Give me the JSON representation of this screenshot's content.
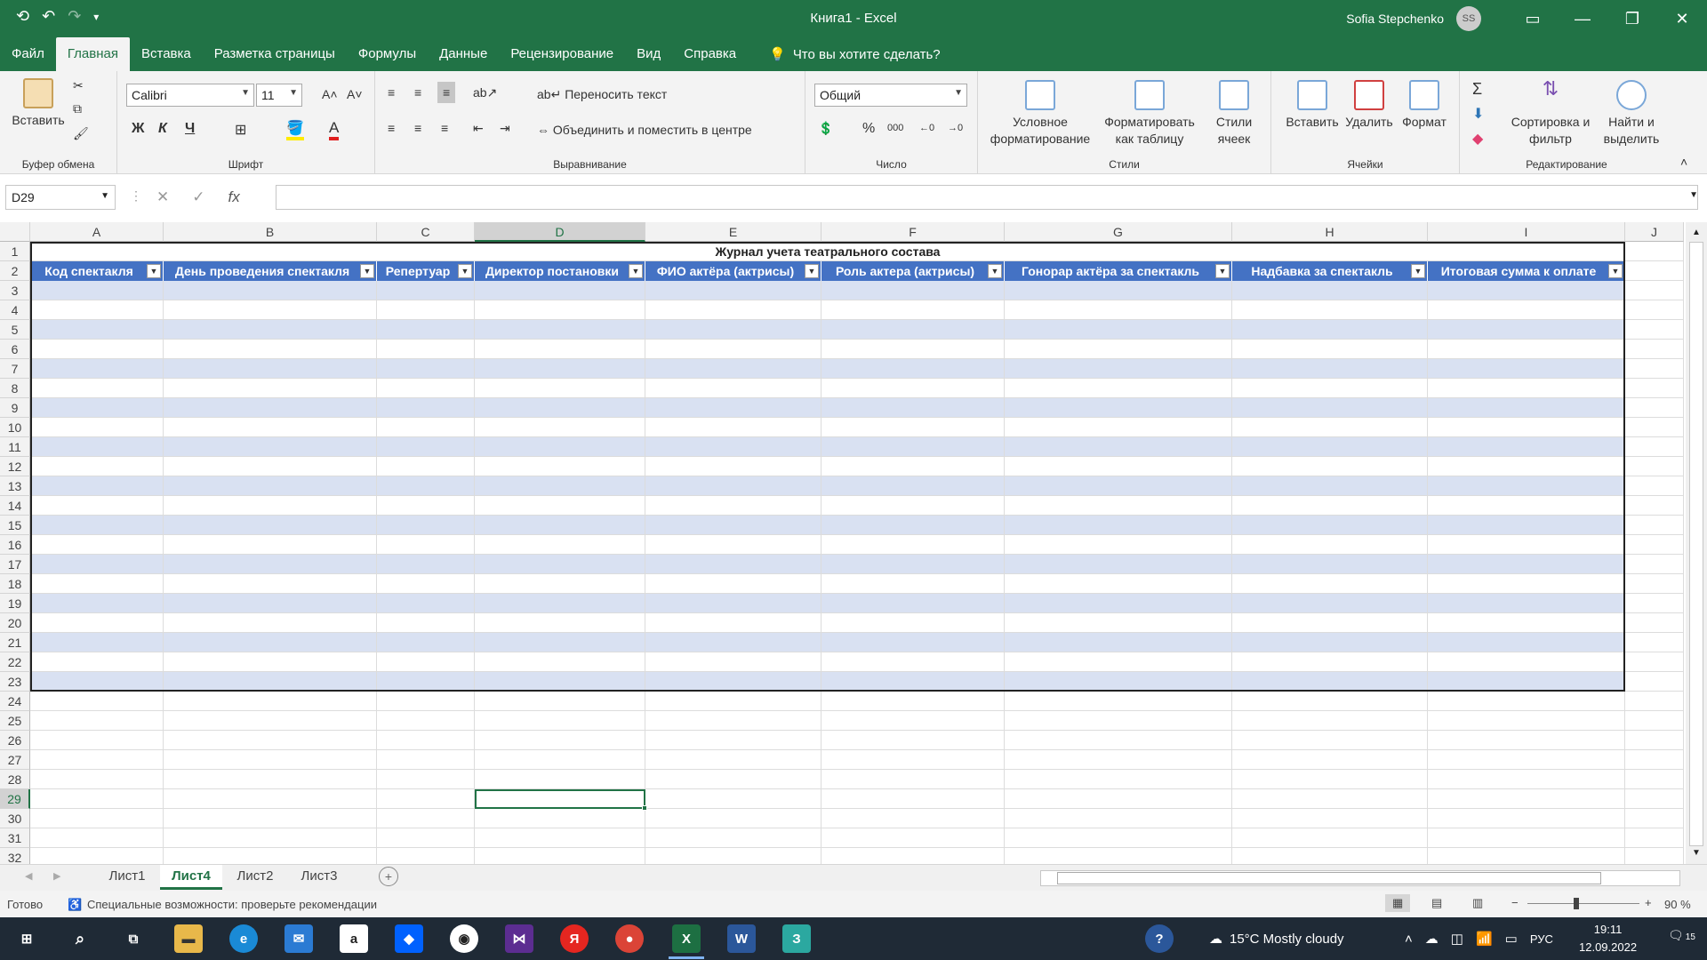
{
  "window": {
    "title": "Книга1  -  Excel",
    "user": "Sofia Stepchenko",
    "initials": "SS"
  },
  "tabs": [
    "Файл",
    "Главная",
    "Вставка",
    "Разметка страницы",
    "Формулы",
    "Данные",
    "Рецензирование",
    "Вид",
    "Справка"
  ],
  "search": "Что вы хотите сделать?",
  "ribbon": {
    "clipboard": {
      "paste": "Вставить",
      "label": "Буфер обмена"
    },
    "font": {
      "name": "Calibri",
      "size": "11",
      "bold": "Ж",
      "italic": "К",
      "underline": "Ч",
      "label": "Шрифт"
    },
    "align": {
      "wrap": "Переносить текст",
      "merge": "Объединить и поместить в центре",
      "label": "Выравнивание"
    },
    "number": {
      "format": "Общий",
      "label": "Число"
    },
    "styles": {
      "cond": "Условное форматирование",
      "table": "Форматировать как таблицу",
      "cell": "Стили ячеек",
      "label": "Стили"
    },
    "cells": {
      "insert": "Вставить",
      "delete": "Удалить",
      "format": "Формат",
      "label": "Ячейки"
    },
    "edit": {
      "sort": "Сортировка и фильтр",
      "find": "Найти и выделить",
      "label": "Редактирование"
    }
  },
  "namebox": "D29",
  "columns": [
    "A",
    "B",
    "C",
    "D",
    "E",
    "F",
    "G",
    "H",
    "I",
    "J"
  ],
  "rows": [
    "1",
    "2",
    "3",
    "4",
    "5",
    "6",
    "7",
    "8",
    "9",
    "10",
    "11",
    "12",
    "13",
    "14",
    "15",
    "16",
    "17",
    "18",
    "19",
    "20",
    "21",
    "22",
    "23",
    "24",
    "25",
    "26",
    "27",
    "28",
    "29",
    "30",
    "31",
    "32"
  ],
  "sheet_title": "Журнал учета театрального состава",
  "table_headers": [
    "Код спектакля",
    "День проведения спектакля",
    "Репертуар",
    "Директор постановки",
    "ФИО актёра (актрисы)",
    "Роль актера (актрисы)",
    "Гонорар актёра за спектакль",
    "Надбавка за спектакль",
    "Итоговая сумма к оплате"
  ],
  "sheets": [
    "Лист1",
    "Лист4",
    "Лист2",
    "Лист3"
  ],
  "status": {
    "ready": "Готово",
    "accessibility": "Специальные возможности: проверьте рекомендации",
    "zoom": "90 %"
  },
  "taskbar": {
    "weather": "15°C  Mostly cloudy",
    "lang": "РУС",
    "time": "19:11",
    "date": "12.09.2022",
    "notif": "15"
  }
}
